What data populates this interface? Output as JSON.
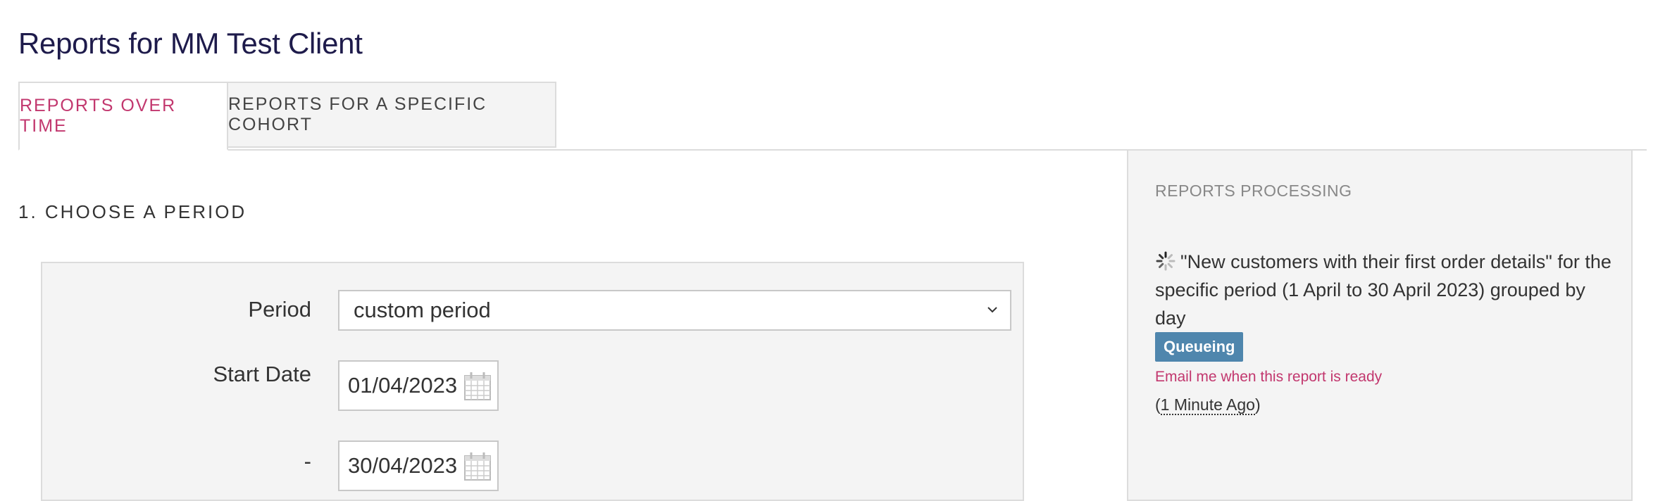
{
  "page": {
    "title": "Reports for MM Test Client"
  },
  "tabs": [
    {
      "label": "REPORTS OVER TIME",
      "active": true
    },
    {
      "label": "REPORTS FOR A SPECIFIC COHORT",
      "active": false
    }
  ],
  "section": {
    "heading": "1. CHOOSE A PERIOD"
  },
  "form": {
    "period_label": "Period",
    "period_value": "custom period",
    "start_label": "Start Date",
    "start_value": "01/04/2023",
    "end_label": "-",
    "end_value": "30/04/2023"
  },
  "sidebar": {
    "title": "REPORTS PROCESSING",
    "report_description": "\"New customers with their first order details\" for the specific period (1 April to 30 April 2023) grouped by day",
    "status": "Queueing",
    "email_link": "Email me when this report is ready",
    "time_open": "(",
    "time_ago": "1 Minute Ago",
    "time_close": ")"
  },
  "colors": {
    "accent": "#c2376e",
    "title": "#1e1b4b",
    "badge": "#4f86ad",
    "panel_bg": "#f4f4f4"
  },
  "icons": {
    "select_arrow": "chevron-down-icon",
    "calendar": "calendar-icon",
    "spinner": "spinner-icon"
  }
}
